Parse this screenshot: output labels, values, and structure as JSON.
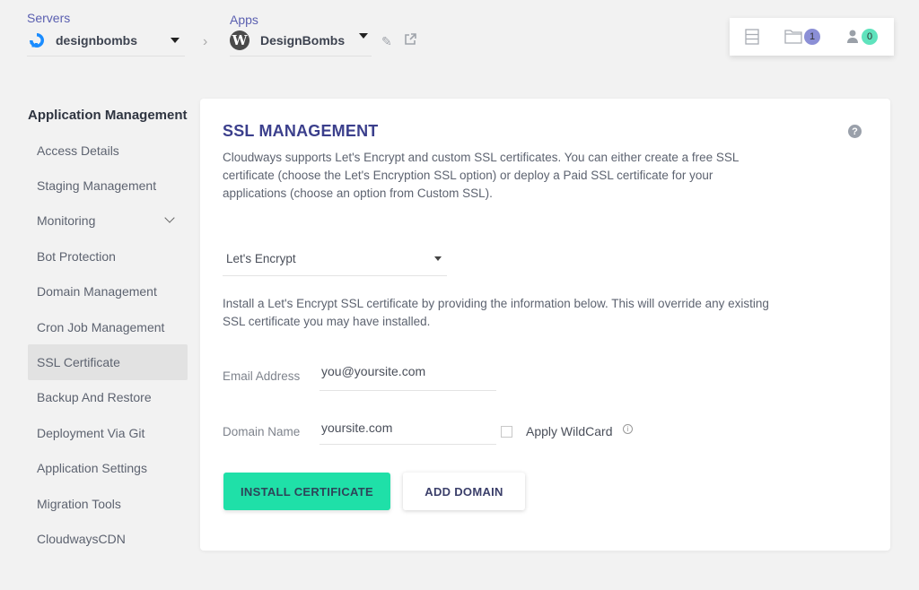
{
  "header": {
    "servers": {
      "label": "Servers",
      "selected": "designbombs"
    },
    "apps": {
      "label": "Apps",
      "selected": "DesignBombs"
    },
    "status": {
      "files_count": "1",
      "users_count": "0",
      "colors": {
        "files_badge": "#8b8fd6",
        "users_badge": "#5fe3bd"
      }
    }
  },
  "sidebar": {
    "title": "Application Management",
    "items": [
      {
        "label": "Access Details"
      },
      {
        "label": "Staging Management"
      },
      {
        "label": "Monitoring",
        "has_submenu": true
      },
      {
        "label": "Bot Protection"
      },
      {
        "label": "Domain Management"
      },
      {
        "label": "Cron Job Management"
      },
      {
        "label": "SSL Certificate",
        "active": true
      },
      {
        "label": "Backup And Restore"
      },
      {
        "label": "Deployment Via Git"
      },
      {
        "label": "Application Settings"
      },
      {
        "label": "Migration Tools"
      },
      {
        "label": "CloudwaysCDN"
      }
    ]
  },
  "main": {
    "title": "SSL MANAGEMENT",
    "intro": "Cloudways supports Let's Encrypt and custom SSL certificates. You can either create a free SSL certificate (choose the Let's Encryption SSL option) or deploy a Paid SSL certificate for your applications (choose an option from Custom SSL).",
    "ssl_type": {
      "selected": "Let's Encrypt"
    },
    "note": "Install a Let's Encrypt SSL certificate by providing the information below. This will override any existing SSL certificate you may have installed.",
    "email": {
      "label": "Email Address",
      "value": "you@yoursite.com"
    },
    "domain": {
      "label": "Domain Name",
      "value": "yoursite.com"
    },
    "wildcard": {
      "label": "Apply WildCard",
      "checked": false
    },
    "buttons": {
      "install": "INSTALL CERTIFICATE",
      "add_domain": "ADD DOMAIN"
    },
    "colors": {
      "accent": "#1fe0a8",
      "title": "#3b3f8c"
    }
  }
}
